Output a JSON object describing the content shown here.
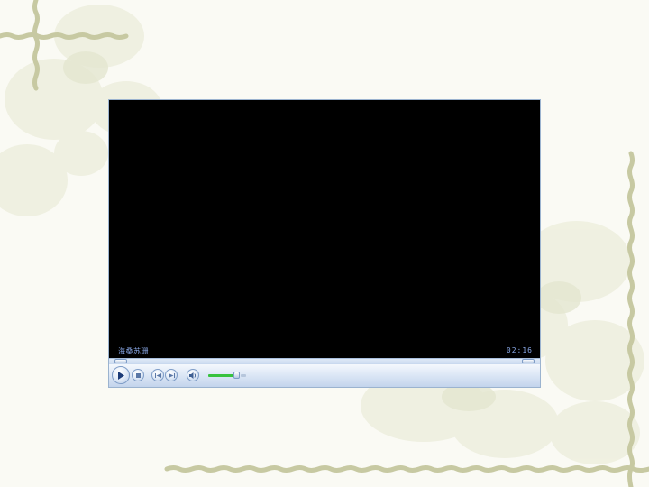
{
  "player": {
    "caption": "海桑苏珊",
    "time": "02:16"
  },
  "icons": {
    "play": "play-icon",
    "stop": "stop-icon",
    "previous": "previous-icon",
    "next": "next-icon",
    "mute": "speaker-icon"
  },
  "colors": {
    "background": "#fafaf4",
    "vine": "#c7c9a2",
    "video": "#000000",
    "caption_text": "#8aa9e8",
    "control_bar": "#dbe6f5",
    "volume_fill": "#37c23e"
  },
  "volume": {
    "level_fraction": 0.8
  }
}
